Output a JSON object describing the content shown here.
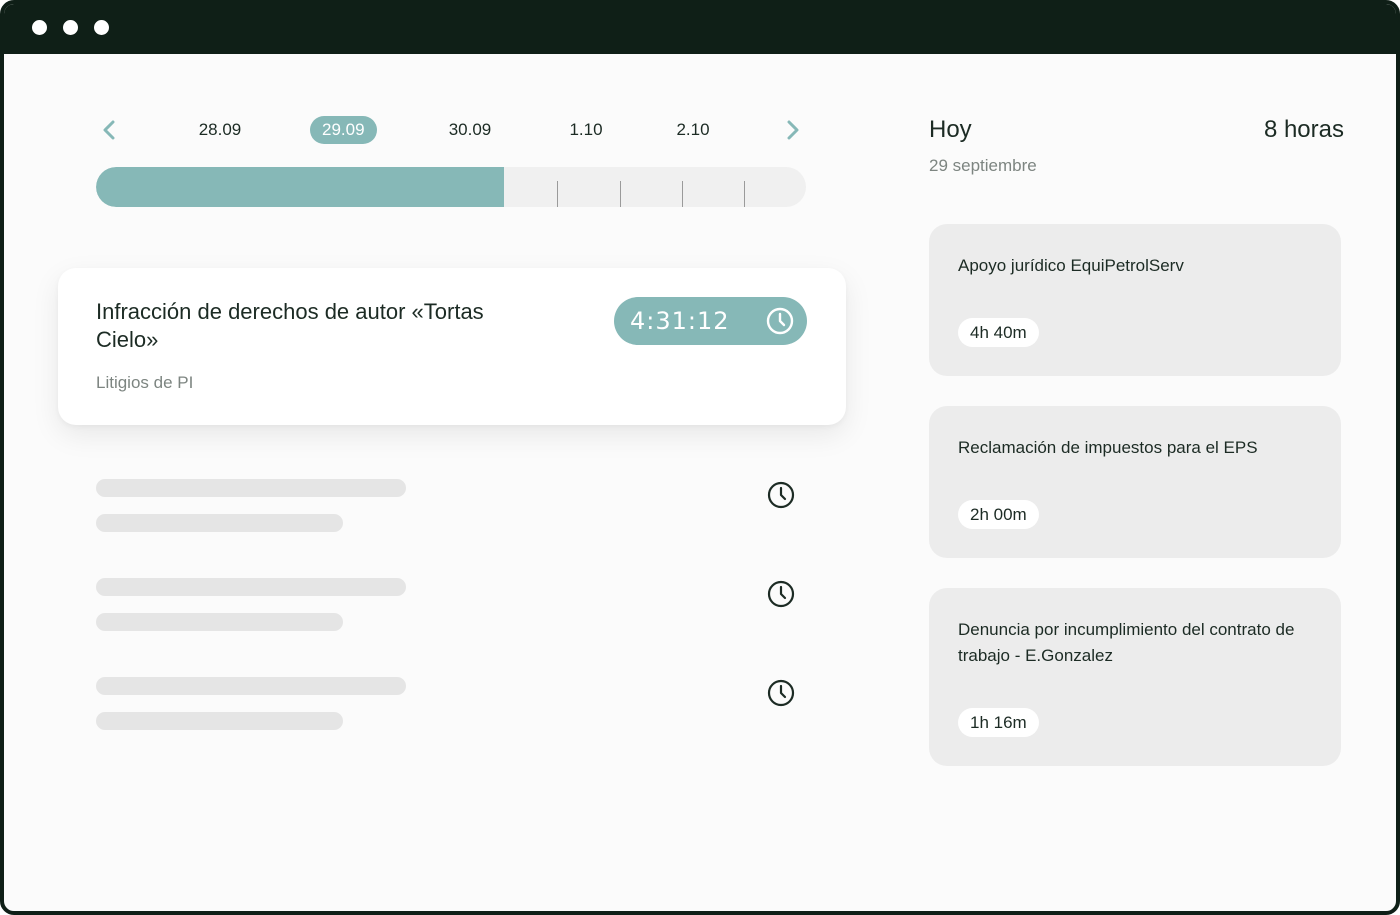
{
  "window": {
    "controls": [
      "close",
      "minimize",
      "maximize"
    ]
  },
  "dates": {
    "prev_icon": "chevron-left-icon",
    "next_icon": "chevron-right-icon",
    "items": [
      {
        "label": "28.09",
        "active": false
      },
      {
        "label": "29.09",
        "active": true
      },
      {
        "label": "30.09",
        "active": false
      },
      {
        "label": "1.10",
        "active": false
      },
      {
        "label": "2.10",
        "active": false
      }
    ]
  },
  "progress": {
    "fraction": 0.575
  },
  "active_task": {
    "title": "Infracción de derechos de autor «Tortas Cielo»",
    "category": "Litigios de PI",
    "timer": "4:31:12",
    "timer_icon": "clock-icon"
  },
  "skeleton_rows": 3,
  "today": {
    "label": "Hoy",
    "date": "29 septiembre",
    "total": "8 horas",
    "entries": [
      {
        "title": "Apoyo jurídico EquiPetrolServ",
        "duration": "4h 40m"
      },
      {
        "title": "Reclamación de impuestos para el EPS",
        "duration": "2h 00m"
      },
      {
        "title": "Denuncia por incumplimiento del contrato de trabajo - E.Gonzalez",
        "duration": "1h 16m"
      }
    ]
  },
  "colors": {
    "accent": "#86b8b7",
    "frame": "#0f1f17",
    "card": "#ececec",
    "skeleton": "#e5e5e5"
  }
}
